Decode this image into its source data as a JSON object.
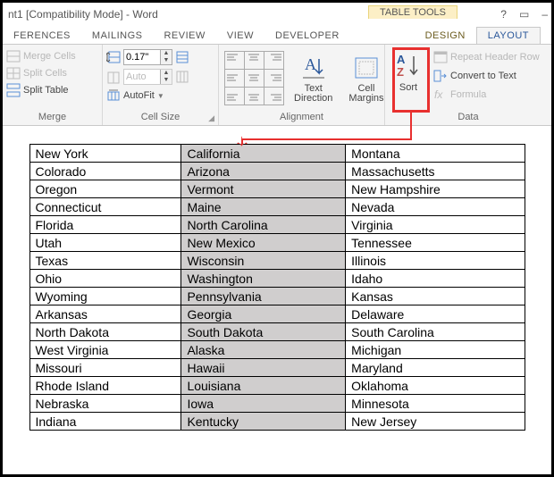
{
  "titlebar": {
    "title": "nt1 [Compatibility Mode] - Word",
    "table_tools": "TABLE TOOLS",
    "help": "?",
    "restore": "▭",
    "minimize": "–"
  },
  "tabs": {
    "references": "FERENCES",
    "mailings": "MAILINGS",
    "review": "REVIEW",
    "view": "VIEW",
    "developer": "DEVELOPER",
    "design": "DESIGN",
    "layout": "LAYOUT"
  },
  "ribbon": {
    "merge": {
      "merge_cells": "Merge Cells",
      "split_cells": "Split Cells",
      "split_table": "Split Table",
      "label": "Merge"
    },
    "cellsize": {
      "height_value": "0.17\"",
      "width_value": "Auto",
      "autofit": "AutoFit",
      "label": "Cell Size"
    },
    "alignment": {
      "text_direction": "Text\nDirection",
      "cell_margins": "Cell\nMargins",
      "label": "Alignment"
    },
    "data": {
      "sort": "Sort",
      "repeat_header": "Repeat Header Row",
      "convert_text": "Convert to Text",
      "formula": "Formula",
      "label": "Data"
    }
  },
  "annot": {
    "down_arrow": "↓"
  },
  "table": {
    "rows": [
      [
        "New York",
        "California",
        "Montana"
      ],
      [
        "Colorado",
        "Arizona",
        "Massachusetts"
      ],
      [
        "Oregon",
        "Vermont",
        "New Hampshire"
      ],
      [
        "Connecticut",
        "Maine",
        "Nevada"
      ],
      [
        "Florida",
        "North Carolina",
        "Virginia"
      ],
      [
        "Utah",
        "New Mexico",
        "Tennessee"
      ],
      [
        "Texas",
        "Wisconsin",
        "Illinois"
      ],
      [
        "Ohio",
        "Washington",
        "Idaho"
      ],
      [
        "Wyoming",
        "Pennsylvania",
        "Kansas"
      ],
      [
        "Arkansas",
        "Georgia",
        "Delaware"
      ],
      [
        "North Dakota",
        "South Dakota",
        "South Carolina"
      ],
      [
        "West Virginia",
        "Alaska",
        "Michigan"
      ],
      [
        "Missouri",
        "Hawaii",
        "Maryland"
      ],
      [
        "Rhode Island",
        "Louisiana",
        "Oklahoma"
      ],
      [
        "Nebraska",
        "Iowa",
        "Minnesota"
      ],
      [
        "Indiana",
        "Kentucky",
        "New Jersey"
      ]
    ]
  }
}
